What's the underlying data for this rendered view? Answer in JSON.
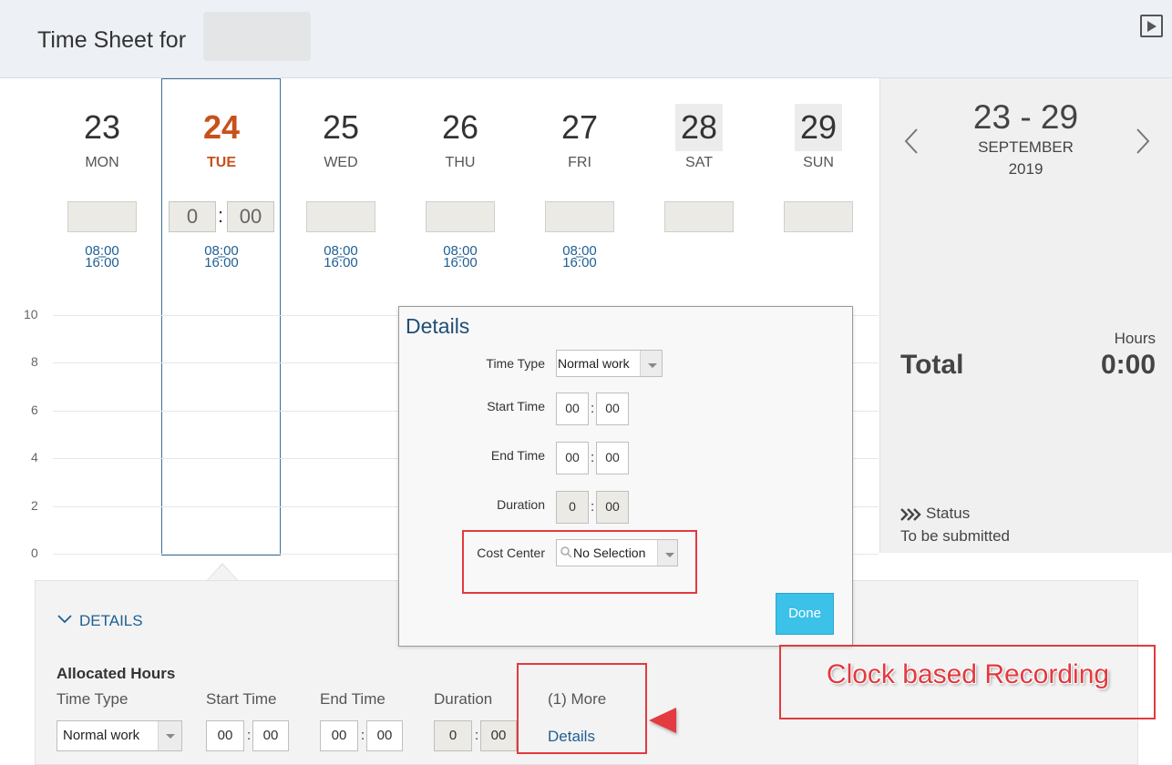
{
  "header": {
    "title": "Time Sheet for",
    "play_icon": "play-icon"
  },
  "days": [
    {
      "num": "23",
      "name": "MON",
      "start": "08:00",
      "dash": "–",
      "end": "16:00"
    },
    {
      "num": "24",
      "name": "TUE",
      "start": "08:00",
      "dash": "–",
      "end": "16:00",
      "today": true
    },
    {
      "num": "25",
      "name": "WED",
      "start": "08:00",
      "dash": "–",
      "end": "16:00"
    },
    {
      "num": "26",
      "name": "THU",
      "start": "08:00",
      "dash": "–",
      "end": "16:00"
    },
    {
      "num": "27",
      "name": "FRI",
      "start": "08:00",
      "dash": "–",
      "end": "16:00"
    },
    {
      "num": "28",
      "name": "SAT"
    },
    {
      "num": "29",
      "name": "SUN"
    }
  ],
  "selected_day_input": {
    "hours": "0",
    "minutes": "00"
  },
  "y_axis": [
    "10",
    "8",
    "6",
    "4",
    "2",
    "0"
  ],
  "week_panel": {
    "range": "23 - 29",
    "month": "SEPTEMBER",
    "year": "2019",
    "hours_label": "Hours",
    "total_label": "Total",
    "total_value": "0:00",
    "status_label": "Status",
    "status_value": "To be submitted"
  },
  "details_section": {
    "toggle_label": "DETAILS",
    "allocated_label": "Allocated Hours",
    "col_time_type": "Time Type",
    "col_start": "Start Time",
    "col_end": "End Time",
    "col_duration": "Duration",
    "time_type_value": "Normal work",
    "start_h": "00",
    "start_m": "00",
    "end_h": "00",
    "end_m": "00",
    "dur_h": "0",
    "dur_m": "00",
    "more_label": "(1) More",
    "details_link": "Details"
  },
  "popup": {
    "title": "Details",
    "time_type_label": "Time Type",
    "time_type_value": "Normal work",
    "start_label": "Start Time",
    "start_h": "00",
    "start_m": "00",
    "end_label": "End Time",
    "end_h": "00",
    "end_m": "00",
    "duration_label": "Duration",
    "dur_h": "0",
    "dur_m": "00",
    "cost_center_label": "Cost Center",
    "cost_center_value": "No Selection",
    "done_label": "Done"
  },
  "annotation": {
    "label": "Clock based Recording",
    "color": "#e23a3f"
  },
  "colors": {
    "accent_link": "#1f5f94",
    "today": "#c8511b",
    "done_button": "#3cc1e8"
  }
}
